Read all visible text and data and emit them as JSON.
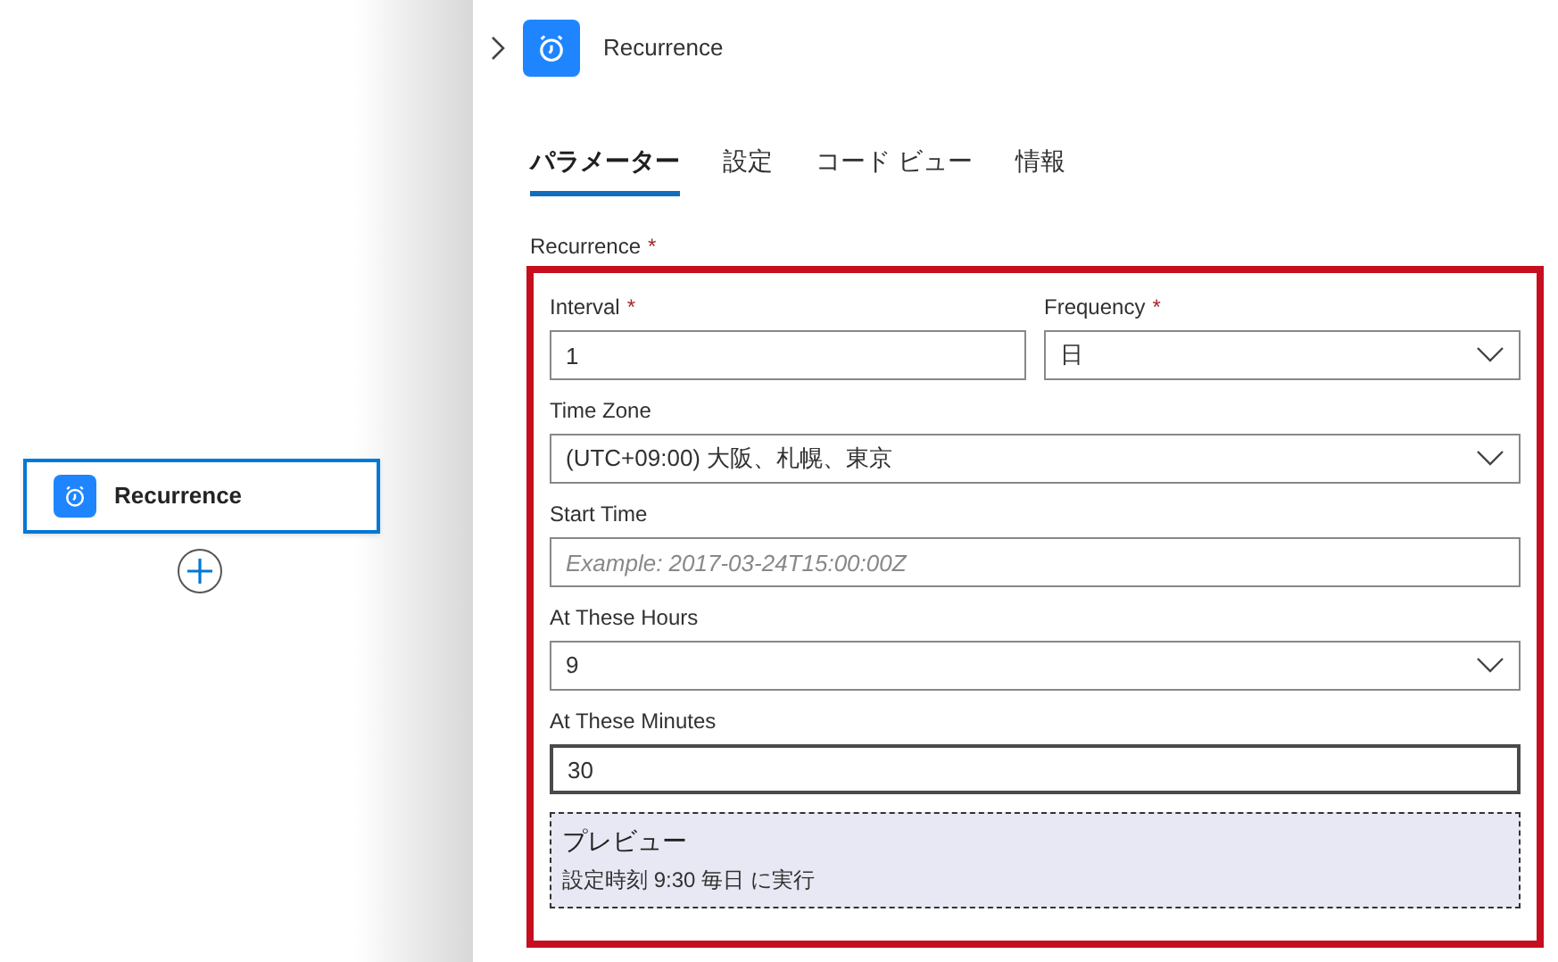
{
  "canvas": {
    "card": {
      "title": "Recurrence",
      "selected": true
    }
  },
  "panel": {
    "title": "Recurrence",
    "tabs": [
      {
        "label": "パラメーター",
        "selected": true
      },
      {
        "label": "設定",
        "selected": false
      },
      {
        "label": "コード ビュー",
        "selected": false
      },
      {
        "label": "情報",
        "selected": false
      }
    ],
    "section": {
      "label": "Recurrence",
      "mark": "*",
      "pair": [
        {
          "label": "Interval",
          "mark": "*",
          "kind": "text",
          "value": "1",
          "focused": false
        },
        {
          "label": "Frequency",
          "mark": "*",
          "kind": "dropdown",
          "value": "日",
          "focused": false
        }
      ],
      "fields": [
        {
          "label": "Time Zone",
          "kind": "dropdown",
          "value": "(UTC+09:00) 大阪、札幌、東京",
          "focused": false
        },
        {
          "label": "Start Time",
          "kind": "text",
          "placeholder": "Example: 2017-03-24T15:00:00Z",
          "focused": false
        },
        {
          "label": "At These Hours",
          "kind": "dropdown",
          "value": "9",
          "focused": false
        },
        {
          "label": "At These Minutes",
          "kind": "text",
          "value": "30",
          "focused": true
        }
      ],
      "preview": {
        "title": "プレビュー",
        "text": "設定時刻 9:30 毎日 に実行"
      }
    }
  }
}
